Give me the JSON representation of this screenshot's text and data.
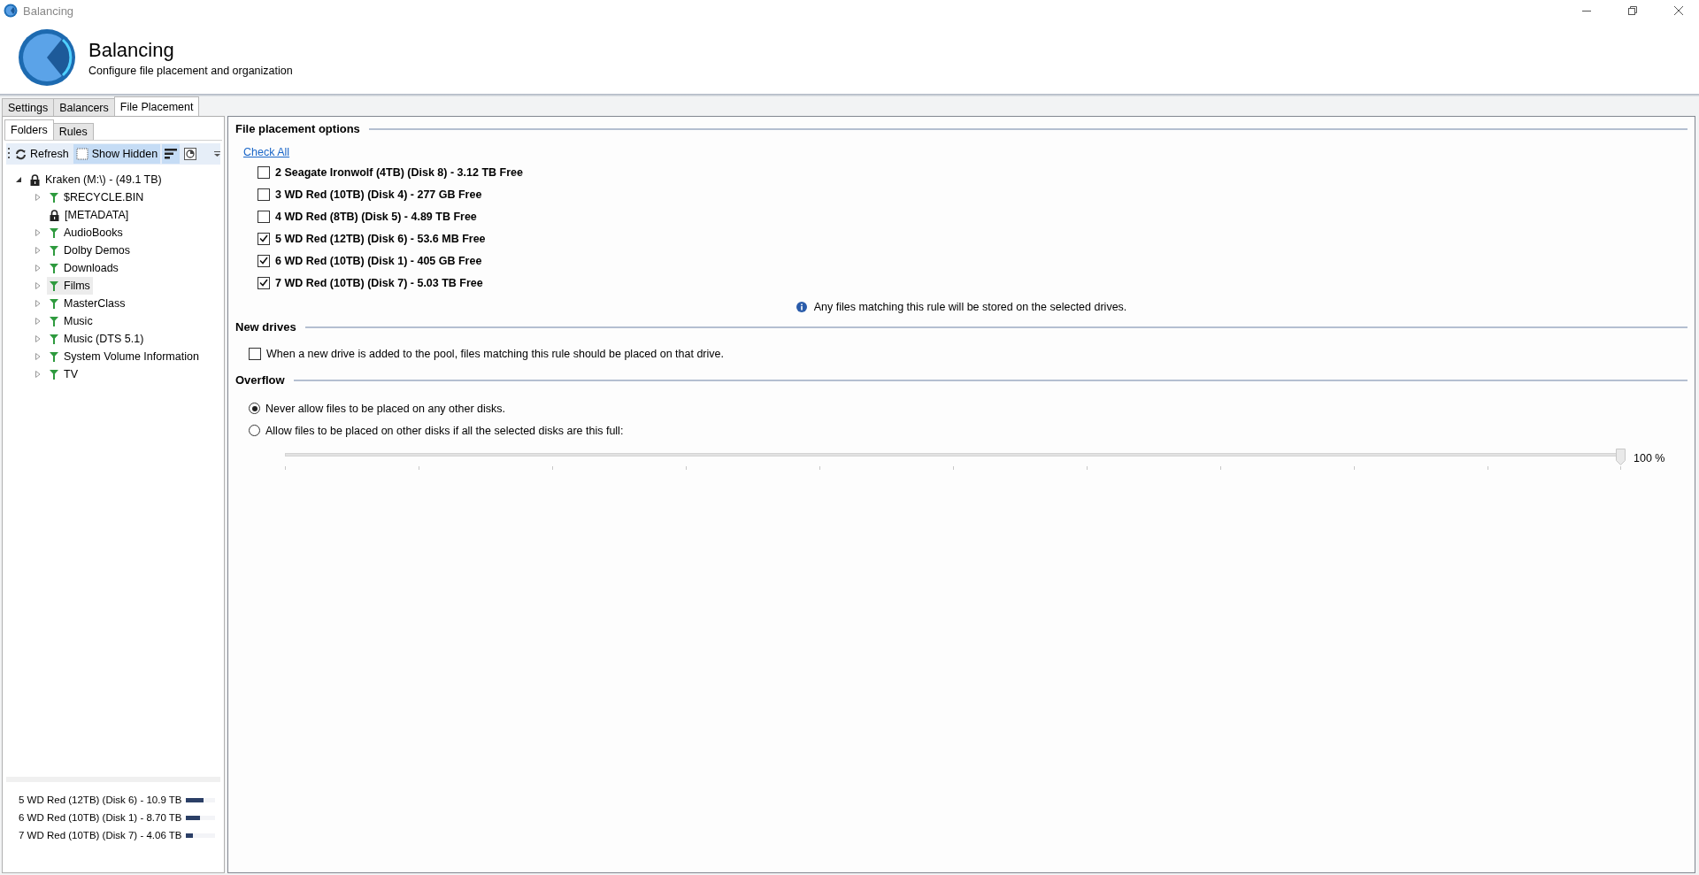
{
  "window": {
    "title": "Balancing"
  },
  "header": {
    "title": "Balancing",
    "subtitle": "Configure file placement and organization"
  },
  "tabs": [
    {
      "label": "Settings",
      "selected": false
    },
    {
      "label": "Balancers",
      "selected": false
    },
    {
      "label": "File Placement",
      "selected": true
    }
  ],
  "left_tabs": [
    {
      "label": "Folders",
      "selected": true
    },
    {
      "label": "Rules",
      "selected": false
    }
  ],
  "toolbar": [
    {
      "kind": "refresh",
      "label": "Refresh",
      "on": false
    },
    {
      "kind": "hidden",
      "label": "Show Hidden",
      "on": true
    },
    {
      "kind": "sort",
      "on": true
    },
    {
      "kind": "chart",
      "on": false
    }
  ],
  "tree": {
    "label": "Kraken (M:\\) - (49.1 TB)",
    "kind": "lock",
    "expanded": true,
    "children": [
      {
        "label": "$RECYCLE.BIN",
        "kind": "filter",
        "expandable": true,
        "selected": false
      },
      {
        "label": "[METADATA]",
        "kind": "lock",
        "expandable": false,
        "selected": false
      },
      {
        "label": "AudioBooks",
        "kind": "filter",
        "expandable": true,
        "selected": false
      },
      {
        "label": "Dolby Demos",
        "kind": "filter",
        "expandable": true,
        "selected": false
      },
      {
        "label": "Downloads",
        "kind": "filter",
        "expandable": true,
        "selected": false
      },
      {
        "label": "Films",
        "kind": "filter",
        "expandable": true,
        "selected": true
      },
      {
        "label": "MasterClass",
        "kind": "filter",
        "expandable": true,
        "selected": false
      },
      {
        "label": "Music",
        "kind": "filter",
        "expandable": true,
        "selected": false
      },
      {
        "label": "Music (DTS 5.1)",
        "kind": "filter",
        "expandable": true,
        "selected": false
      },
      {
        "label": "System Volume Information",
        "kind": "filter",
        "expandable": true,
        "selected": false
      },
      {
        "label": "TV",
        "kind": "filter",
        "expandable": true,
        "selected": false
      }
    ]
  },
  "disk_usage": [
    {
      "label": "5 WD Red (12TB) (Disk 6) - 10.9 TB",
      "level": 0.6
    },
    {
      "label": "6 WD Red (10TB) (Disk 1) - 8.70 TB",
      "level": 0.48
    },
    {
      "label": "7 WD Red (10TB) (Disk 7) - 4.06 TB",
      "level": 0.22
    }
  ],
  "file_placement": {
    "title": "File placement options",
    "check_all": "Check All",
    "drives": [
      {
        "label": "2 Seagate Ironwolf (4TB) (Disk 8) - 3.12 TB Free",
        "checked": false
      },
      {
        "label": "3 WD Red (10TB) (Disk 4) - 277 GB Free",
        "checked": false
      },
      {
        "label": "4 WD Red (8TB) (Disk 5) - 4.89 TB Free",
        "checked": false
      },
      {
        "label": "5 WD Red (12TB) (Disk 6) - 53.6 MB Free",
        "checked": true
      },
      {
        "label": "6 WD Red (10TB) (Disk 1) - 405 GB Free",
        "checked": true
      },
      {
        "label": "7 WD Red (10TB) (Disk 7) - 5.03 TB Free",
        "checked": true
      }
    ],
    "info": "Any files matching this rule will be stored on the selected drives."
  },
  "new_drives": {
    "title": "New drives",
    "option": {
      "label": "When a new drive is added to the pool, files matching this rule should be placed on that drive.",
      "checked": false
    }
  },
  "overflow": {
    "title": "Overflow",
    "options": [
      {
        "label": "Never allow files to be placed on any other disks.",
        "selected": true
      },
      {
        "label": "Allow files to be placed on other disks if all the selected disks are this full:",
        "selected": false
      }
    ],
    "level": 1,
    "reading": "100 %"
  }
}
